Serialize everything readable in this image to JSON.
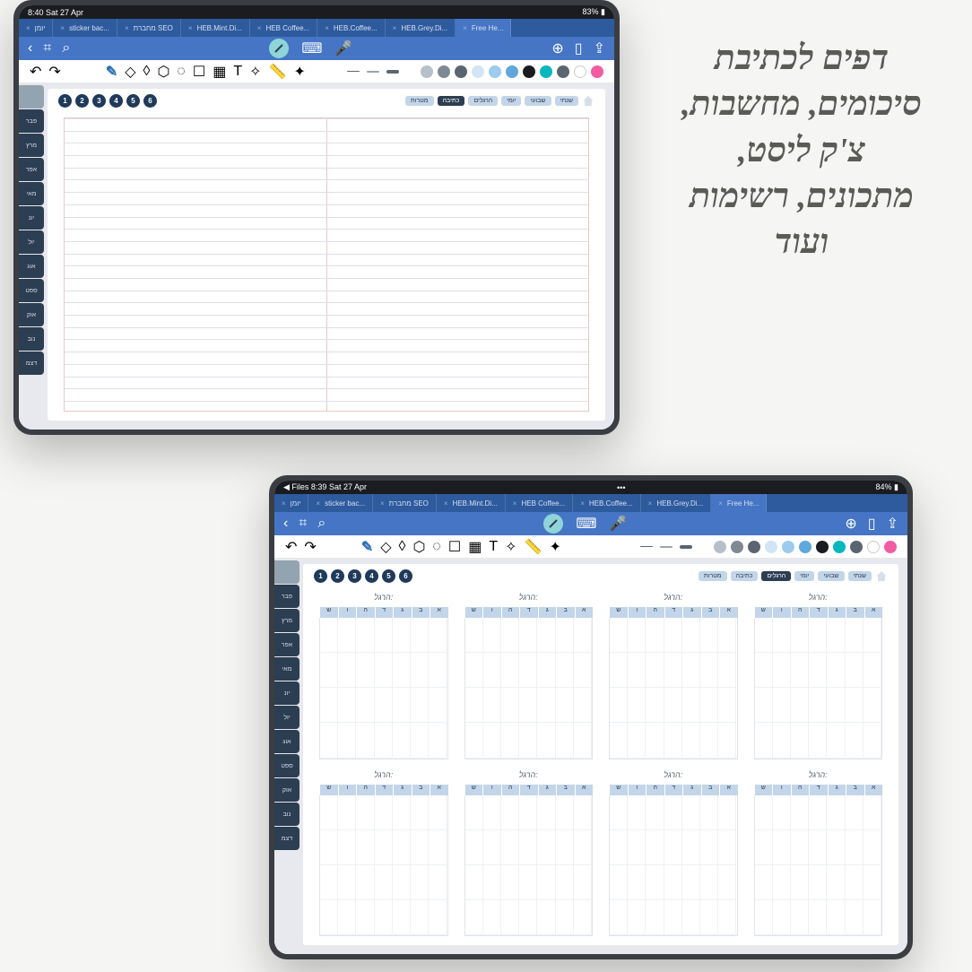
{
  "promo_text": "דפים לכתיבת\nסיכומים, מחשבות,\nצ'ק ליסט,\nמתכונים, רשימות\nועוד",
  "device1": {
    "statusbar": {
      "left": "8:40  Sat 27 Apr",
      "right": "83% ▮"
    },
    "tabs": [
      {
        "label": "יומן"
      },
      {
        "label": "sticker bac..."
      },
      {
        "label": "מחברת SEO"
      },
      {
        "label": "HEB.Mint.Di..."
      },
      {
        "label": "HEB Coffee..."
      },
      {
        "label": "HEB.Coffee..."
      },
      {
        "label": "HEB.Grey.Di..."
      },
      {
        "label": "Free He...",
        "active": true
      }
    ],
    "colors": [
      "#b7bfc8",
      "#7f8993",
      "#5a6570",
      "#d2e5f5",
      "#9dcbee",
      "#5fa8dc",
      "#1a1c20",
      "#06b7bd",
      "#5a6570",
      "#ffffff",
      "#f25ca2"
    ],
    "nums": [
      "1",
      "2",
      "3",
      "4",
      "5",
      "6"
    ],
    "cats": [
      {
        "t": "מטרות"
      },
      {
        "t": "כתיבה",
        "dark": true
      },
      {
        "t": "הרגלים"
      },
      {
        "t": "יומי"
      },
      {
        "t": "שבועי"
      },
      {
        "t": "שנתי"
      }
    ],
    "sidetabs": [
      "",
      "פבר",
      "מרץ",
      "אפר",
      "מאי",
      "יונ",
      "יול",
      "אוג",
      "ספט",
      "אוק",
      "נוב",
      "דצמ"
    ]
  },
  "device2": {
    "statusbar": {
      "left": "◀ Files  8:39  Sat 27 Apr",
      "right": "84% ▮"
    },
    "tabs": [
      {
        "label": "יומן"
      },
      {
        "label": "sticker bac..."
      },
      {
        "label": "מחברת SEO"
      },
      {
        "label": "HEB.Mint.Di..."
      },
      {
        "label": "HEB Coffee..."
      },
      {
        "label": "HEB.Coffee..."
      },
      {
        "label": "HEB.Grey.Di..."
      },
      {
        "label": "Free He...",
        "active": true
      }
    ],
    "nums": [
      "1",
      "2",
      "3",
      "4",
      "5",
      "6"
    ],
    "cats": [
      {
        "t": "מטרות"
      },
      {
        "t": "כתיבה"
      },
      {
        "t": "הרגלים",
        "dark": true
      },
      {
        "t": "יומי"
      },
      {
        "t": "שבועי"
      },
      {
        "t": "שנתי"
      }
    ],
    "sidetabs": [
      "",
      "פבר",
      "מרץ",
      "אפר",
      "מאי",
      "יונ",
      "יול",
      "אוג",
      "ספט",
      "אוק",
      "נוב",
      "דצמ"
    ],
    "habit_label": ":הרגל",
    "days": [
      "א",
      "ב",
      "ג",
      "ד",
      "ה",
      "ו",
      "ש"
    ]
  }
}
